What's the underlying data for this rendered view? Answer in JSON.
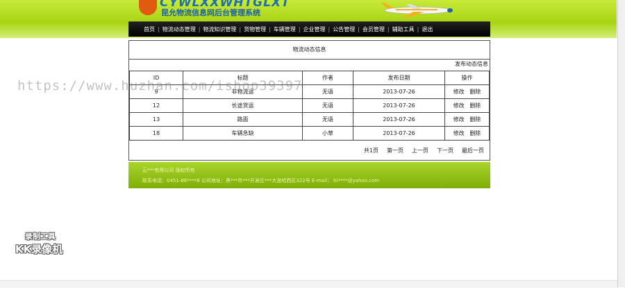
{
  "header": {
    "logo_en": "CYWLXXWHTGLXT",
    "logo_cn": "昆允物流信息网后台管理系统"
  },
  "nav": {
    "items": [
      "首页",
      "物流动态管理",
      "物流知识管理",
      "货物管理",
      "车辆管理",
      "企业管理",
      "公告管理",
      "会员管理",
      "辅助工具",
      "退出"
    ]
  },
  "panel": {
    "title": "物流动态信息",
    "publish_link": "发布动态信息",
    "columns": [
      "ID",
      "标题",
      "作者",
      "发布日期",
      "操作"
    ],
    "rows": [
      {
        "id": "9",
        "title": "非物流运",
        "author": "无语",
        "date": "2013-07-26",
        "edit": "修改",
        "del": "删除"
      },
      {
        "id": "12",
        "title": "长途货运",
        "author": "无语",
        "date": "2013-07-26",
        "edit": "修改",
        "del": "删除"
      },
      {
        "id": "13",
        "title": "路面",
        "author": "无语",
        "date": "2013-07-26",
        "edit": "修改",
        "del": "删除"
      },
      {
        "id": "18",
        "title": "车辆急缺",
        "author": "小草",
        "date": "2013-07-26",
        "edit": "修改",
        "del": "删除"
      }
    ],
    "pager": [
      "共1页",
      "第一页",
      "上一页",
      "下一页",
      "最后一页"
    ]
  },
  "footer": {
    "line1": "云***有限公司    版权所有",
    "line2": "联系电话：0451-86****8    公司地址：黑***市***开发区***大道哈西区322号    E-mail：   hi****@yahoo.com"
  },
  "watermark": "https://www.huzhan.com/ishop39397",
  "recorder": {
    "line1": "录制工具",
    "line2": "KK录像机"
  }
}
